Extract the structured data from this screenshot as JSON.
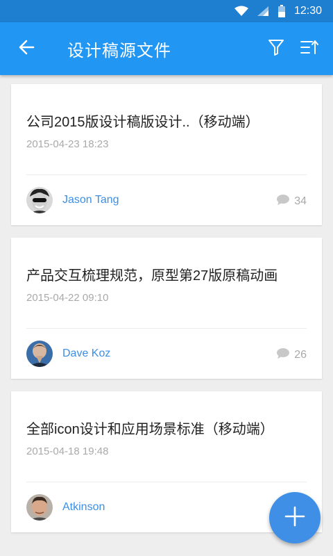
{
  "status_bar": {
    "time": "12:30"
  },
  "app_bar": {
    "title": "设计稿源文件",
    "icons": [
      "back-arrow-icon",
      "filter-icon",
      "sort-icon"
    ]
  },
  "posts": [
    {
      "title": "公司2015版设计稿版设计..（移动端）",
      "date": "2015-04-23 18:23",
      "author": "Jason Tang",
      "comments": "34"
    },
    {
      "title": "产品交互梳理规范，原型第27版原稿动画",
      "date": "2015-04-22 09:10",
      "author": "Dave Koz",
      "comments": "26"
    },
    {
      "title": "全部icon设计和应用场景标准（移动端）",
      "date": "2015-04-18 19:48",
      "author": "Atkinson",
      "comments": ""
    }
  ],
  "fab": {
    "icon": "plus-icon"
  },
  "colors": {
    "status_bar": "#1e7fd0",
    "app_bar": "#2196f3",
    "link": "#3a8ee6",
    "fab": "#3f8fe6"
  }
}
